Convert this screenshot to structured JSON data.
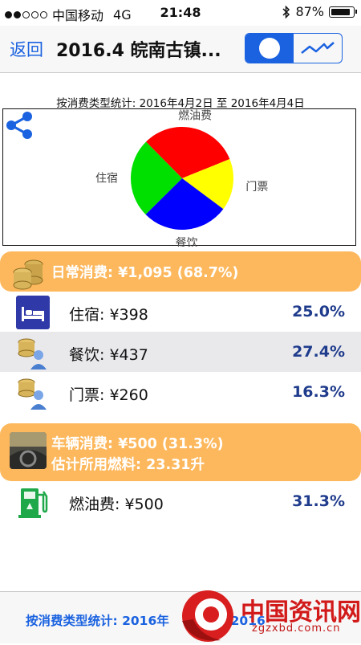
{
  "status": {
    "carrier": "中国移动",
    "network": "4G",
    "time": "21:48",
    "battery": "87%",
    "signal_bars_filled": 2,
    "signal_bars_total": 5
  },
  "nav": {
    "back_label": "返回",
    "title": "2016.4 皖南古镇..."
  },
  "chart": {
    "caption": "按消费类型统计: 2016年4月2日 至 2016年4月4日"
  },
  "chart_data": {
    "type": "pie",
    "slices": [
      {
        "label": "燃油费",
        "value": 31.3,
        "color": "#ff0000"
      },
      {
        "label": "门票",
        "value": 16.3,
        "color": "#ffff00"
      },
      {
        "label": "餐饮",
        "value": 27.4,
        "color": "#0000ff"
      },
      {
        "label": "住宿",
        "value": 25.0,
        "color": "#00e000"
      }
    ]
  },
  "daily_group": {
    "label": "日常消费: ¥1,095 (68.7%)",
    "items": [
      {
        "label": "住宿: ¥398",
        "percent": "25.0%",
        "icon": "bed-icon"
      },
      {
        "label": "餐饮: ¥437",
        "percent": "27.4%",
        "icon": "coins-person-icon"
      },
      {
        "label": "门票: ¥260",
        "percent": "16.3%",
        "icon": "coins-person-icon"
      }
    ]
  },
  "vehicle_group": {
    "label": "车辆消费: ¥500 (31.3%)",
    "fuel_label": "估计所用燃料: 23.31升",
    "items": [
      {
        "label": "燃油费: ¥500",
        "percent": "31.3%",
        "icon": "gas-pump-icon"
      }
    ]
  },
  "footer": {
    "text": "按消费类型统计: 2016年",
    "text_tail": "至 2016"
  },
  "watermark": {
    "text": "中国资讯网",
    "url": "zgzxbd.com.cn"
  },
  "colors": {
    "accent": "#1a62e0",
    "group_header": "#fdb85d",
    "percent": "#1f3b8c"
  }
}
